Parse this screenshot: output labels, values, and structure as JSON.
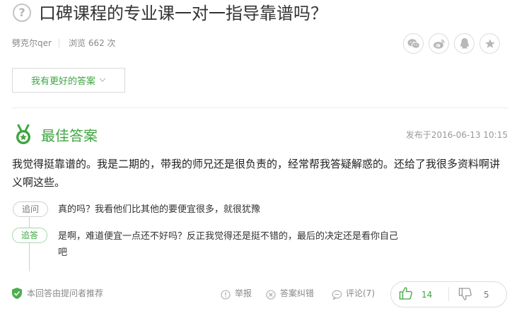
{
  "question": {
    "title": "口碑课程的专业课一对一指导靠谱吗？",
    "icon": "question-circle-icon"
  },
  "meta": {
    "author": "劈克尔qer",
    "views": "浏览 662 次"
  },
  "share": {
    "icons": [
      "wechat-icon",
      "weibo-icon",
      "qq-icon",
      "favorite-star-icon"
    ]
  },
  "better_answer_button": {
    "label": "我有更好的答案"
  },
  "best_answer": {
    "heading": "最佳答案",
    "published": "发布于2016-06-13 10:15",
    "text": "我觉得挺靠谱的。我是二期的，带我的师兄还是很负责的，经常帮我答疑解惑的。还给了我很多资料啊讲义啊这些。",
    "followups": [
      {
        "tag": "追问",
        "text": "真的吗？我看他们比其他的要便宜很多，就很犹豫"
      },
      {
        "tag": "追答",
        "text": "是啊，难道便宜一点还不好吗？反正我觉得还是挺不错的，最后的决定还是看你自己吧"
      }
    ]
  },
  "footer": {
    "recommended": "本回答由提问者推荐",
    "report": "举报",
    "correction": "答案纠错",
    "comments": "评论(7)",
    "upvotes": "14",
    "downvotes": "5"
  },
  "colors": {
    "accent_green": "#3fa542",
    "muted_gray": "#888888"
  }
}
